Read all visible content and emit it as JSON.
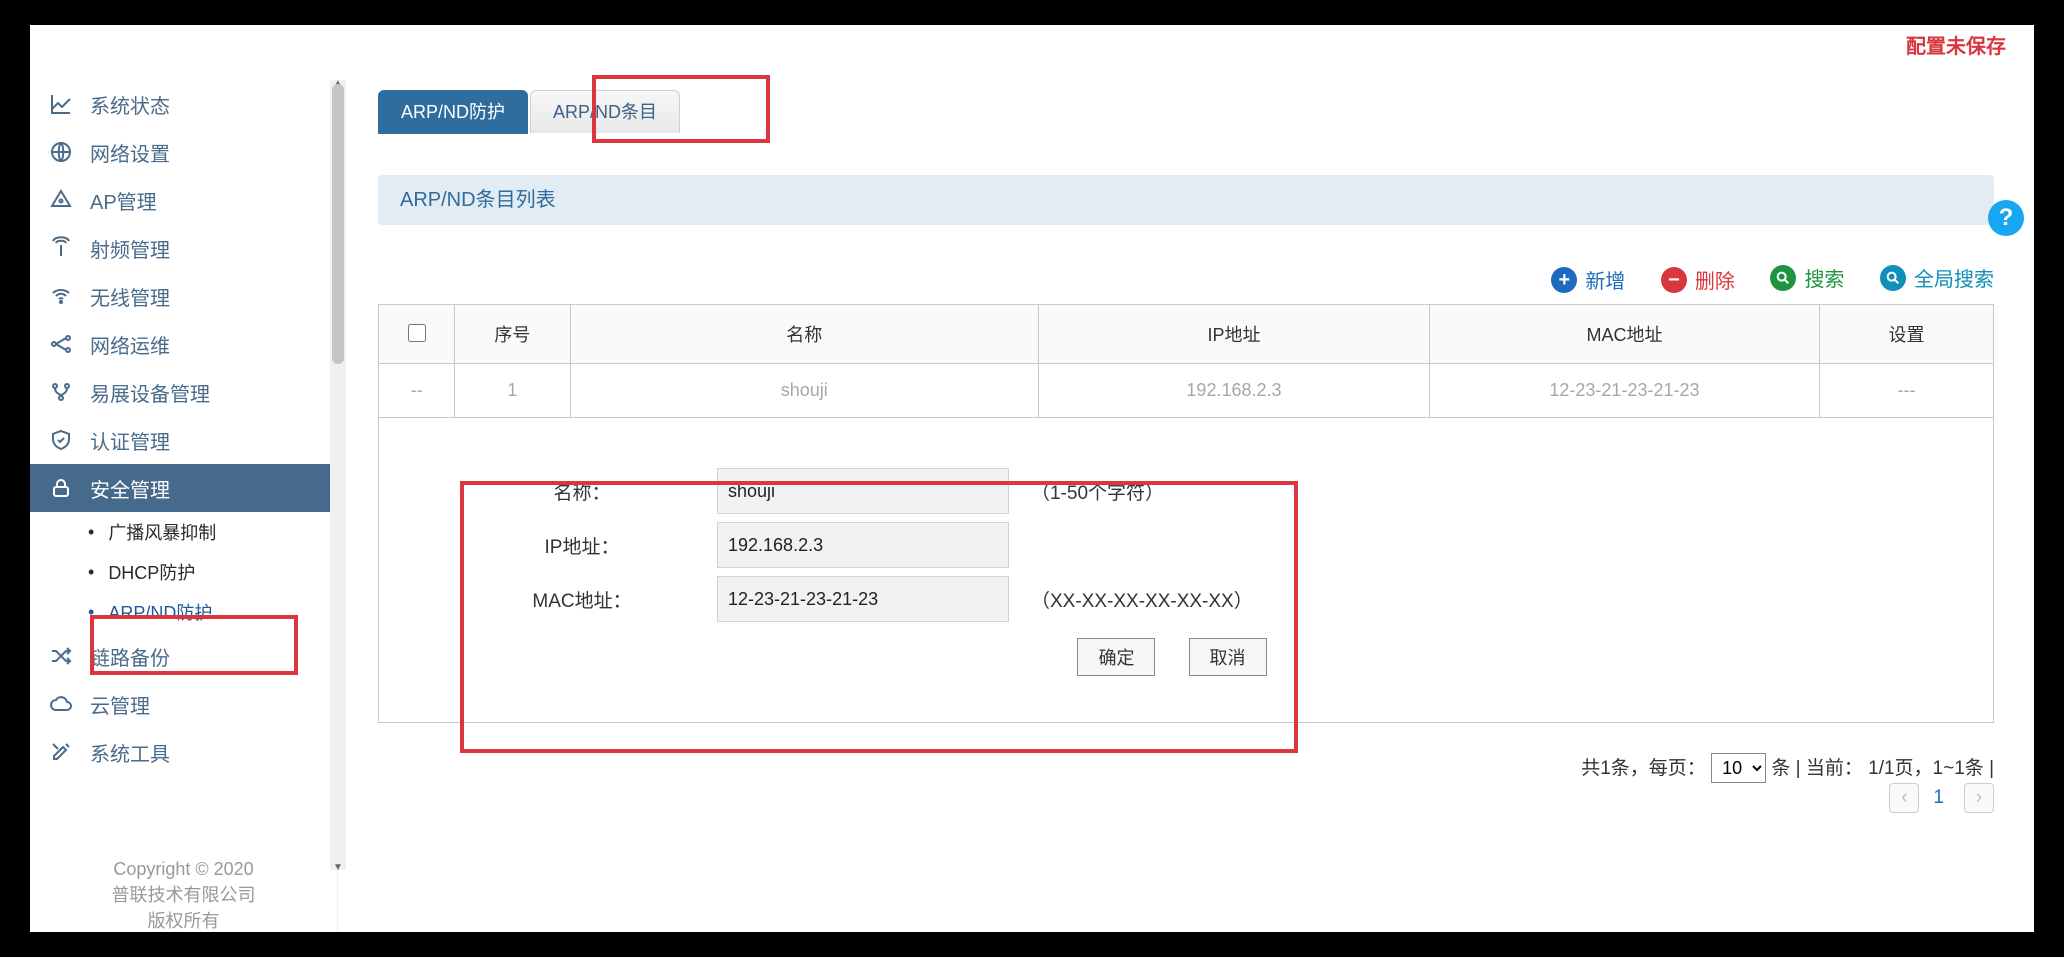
{
  "header": {
    "unsaved": "配置未保存"
  },
  "help_label": "帮助",
  "sidebar": {
    "items": [
      {
        "label": "系统状态"
      },
      {
        "label": "网络设置"
      },
      {
        "label": "AP管理"
      },
      {
        "label": "射频管理"
      },
      {
        "label": "无线管理"
      },
      {
        "label": "网络运维"
      },
      {
        "label": "易展设备管理"
      },
      {
        "label": "认证管理"
      },
      {
        "label": "安全管理"
      },
      {
        "label": "链路备份"
      },
      {
        "label": "云管理"
      },
      {
        "label": "系统工具"
      }
    ],
    "security_submenu": [
      {
        "label": "广播风暴抑制"
      },
      {
        "label": "DHCP防护"
      },
      {
        "label": "ARP/ND防护"
      }
    ],
    "copyright": [
      "Copyright © 2020",
      "普联技术有限公司",
      "版权所有"
    ]
  },
  "tabs": {
    "t0": "ARP/ND防护",
    "t1": "ARP/ND条目"
  },
  "panel_title": "ARP/ND条目列表",
  "actions": {
    "add": "新增",
    "delete": "删除",
    "search": "搜索",
    "gsearch": "全局搜索"
  },
  "table": {
    "headers": {
      "seq": "序号",
      "name": "名称",
      "ip": "IP地址",
      "mac": "MAC地址",
      "act": "设置"
    },
    "rows": [
      {
        "check": "--",
        "seq": "1",
        "name": "shouji",
        "ip": "192.168.2.3",
        "mac": "12-23-21-23-21-23",
        "act": "---"
      }
    ]
  },
  "form": {
    "name_label": "名称：",
    "name_value": "shouji",
    "name_hint": "（1-50个字符）",
    "ip_label": "IP地址：",
    "ip_value": "192.168.2.3",
    "mac_label": "MAC地址：",
    "mac_value": "12-23-21-23-21-23",
    "mac_hint": "（XX-XX-XX-XX-XX-XX）",
    "ok": "确定",
    "cancel": "取消"
  },
  "pager": {
    "total_prefix": "共",
    "total_count": "1",
    "total_suffix": "条，每页：",
    "per_page": "10",
    "per_suffix": "条 | 当前：",
    "page_info": "1/1页，1~1条",
    "bar": " |",
    "page_num": "1"
  }
}
